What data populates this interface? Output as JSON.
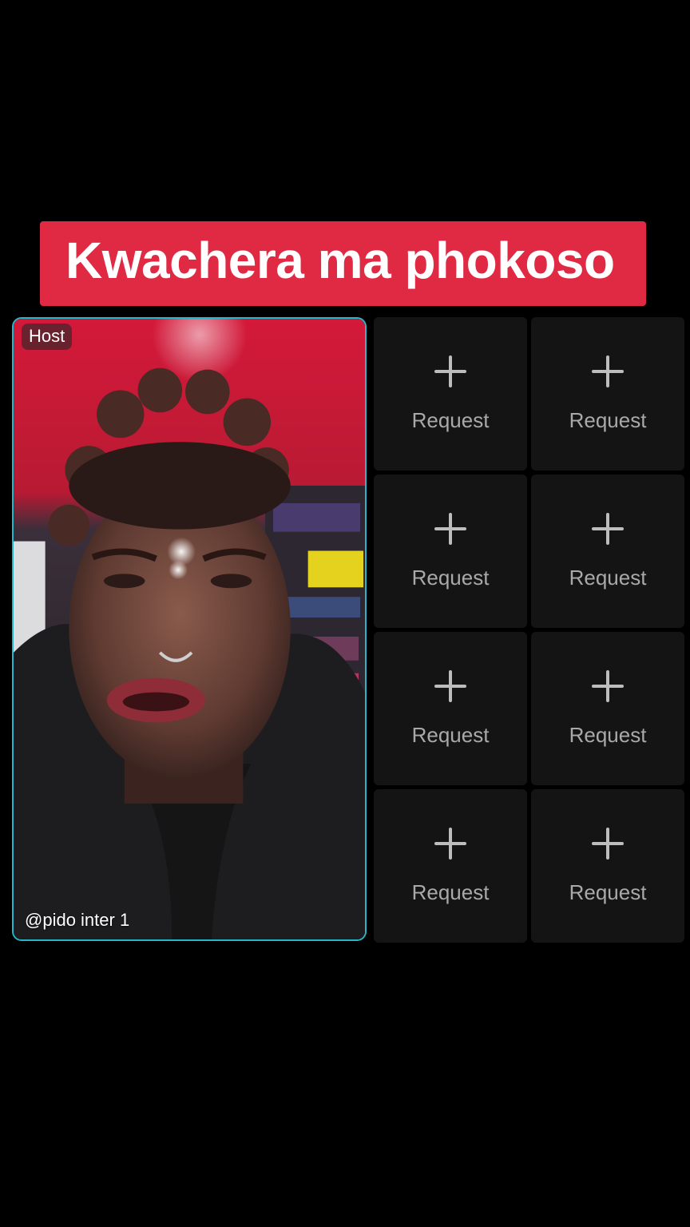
{
  "caption": {
    "text": "Kwachera ma phokoso"
  },
  "host_tile": {
    "badge": "Host",
    "username": "@pido inter 1",
    "accent_color": "#27b6c9"
  },
  "request_slots": [
    {
      "label": "Request",
      "icon": "plus-icon"
    },
    {
      "label": "Request",
      "icon": "plus-icon"
    },
    {
      "label": "Request",
      "icon": "plus-icon"
    },
    {
      "label": "Request",
      "icon": "plus-icon"
    },
    {
      "label": "Request",
      "icon": "plus-icon"
    },
    {
      "label": "Request",
      "icon": "plus-icon"
    },
    {
      "label": "Request",
      "icon": "plus-icon"
    },
    {
      "label": "Request",
      "icon": "plus-icon"
    }
  ],
  "colors": {
    "background": "#000000",
    "caption_banner": "#e02a44",
    "slot_background": "#141414"
  }
}
